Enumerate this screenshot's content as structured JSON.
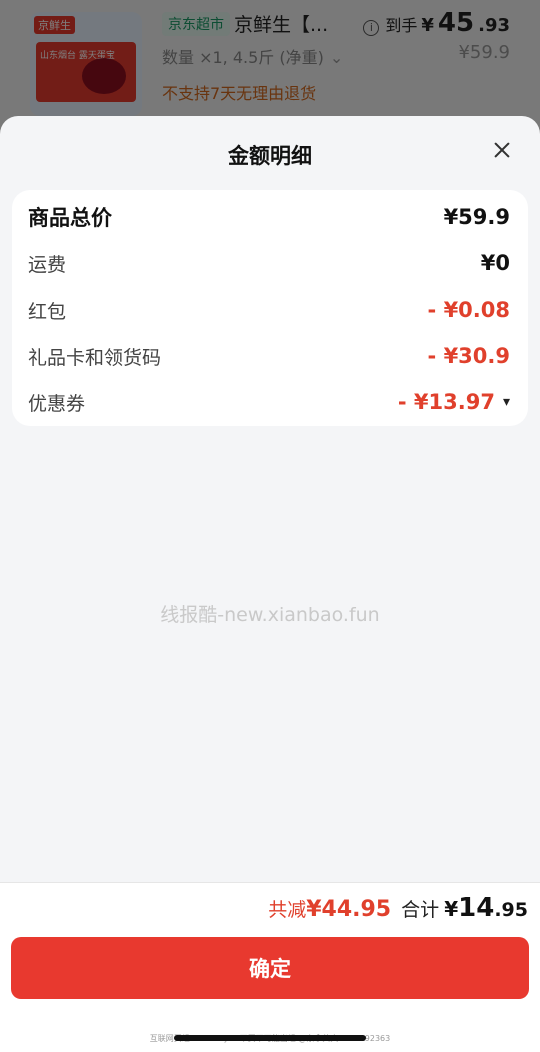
{
  "product": {
    "thumb_tag": "京鲜生",
    "thumb_text": "山东烟台 露天蛋宝",
    "store_tag": "京东超市",
    "title": "京鲜生【...",
    "spec": "数量 ×1, 4.5斤 (净重)",
    "return_policy": "不支持7天无理由退货",
    "price_label": "到手",
    "price_yen": "¥",
    "price_int": "45",
    "price_dec": ".93",
    "original_price": "¥59.9"
  },
  "sheet": {
    "title": "金额明细",
    "rows": [
      {
        "label": "商品总价",
        "value": "¥59.9"
      },
      {
        "label": "运费",
        "value": "¥0"
      },
      {
        "label": "红包",
        "value": "- ¥0.08"
      },
      {
        "label": "礼品卡和领货码",
        "value": "- ¥30.9"
      },
      {
        "label": "优惠券",
        "value": "- ¥13.97"
      }
    ],
    "watermark": "线报酷-new.xianbao.fun"
  },
  "footer": {
    "discount_label": "共减",
    "discount_amount": "¥44.95",
    "total_label": "合计",
    "total_yen": "¥",
    "total_int": "14",
    "total_dec": ".95",
    "confirm_label": "确定",
    "footnote": "互联网买组 & All buy & 不买不可能出组 @东拿共大 ID: 5192363"
  },
  "colors": {
    "accent_red": "#e8392f",
    "discount_red": "#e0402c",
    "store_tag_green": "#1a9b66"
  }
}
